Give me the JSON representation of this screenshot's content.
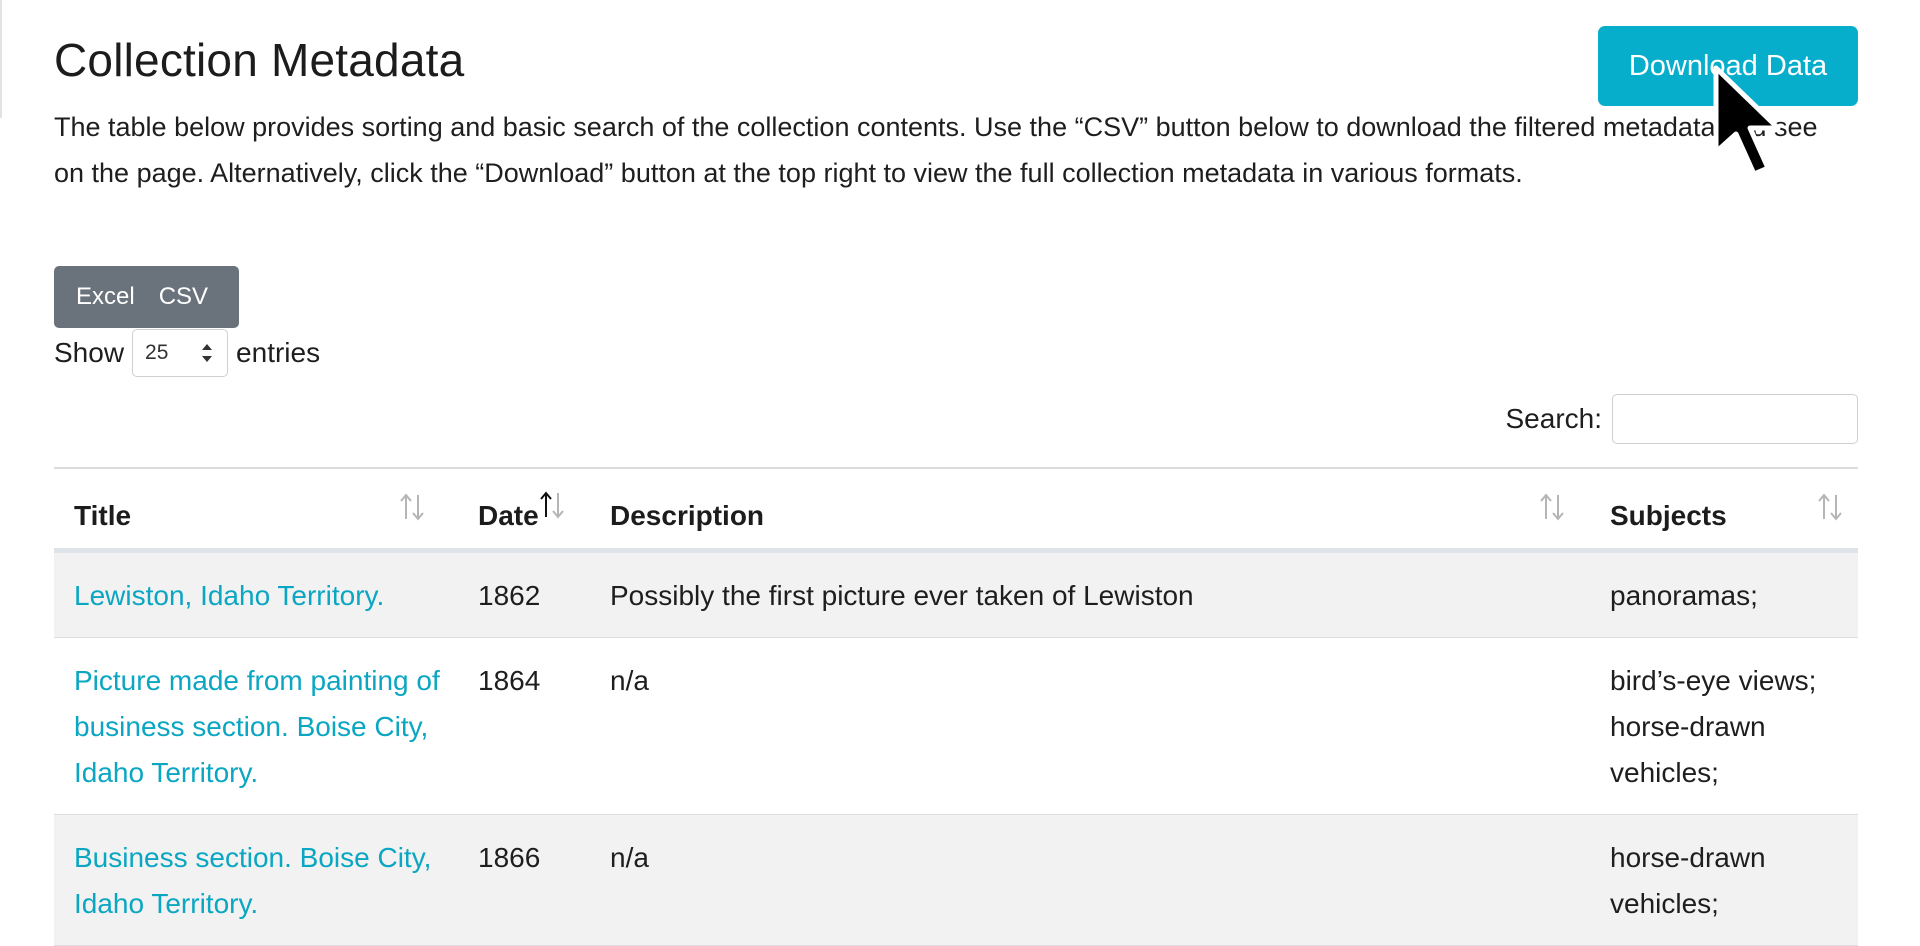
{
  "page": {
    "title": "Collection Metadata",
    "intro": "The table below provides sorting and basic search of the collection contents. Use the “CSV” button below to download the filtered metadata you see on the page. Alternatively, click the “Download” button at the top right to view the full collection metadata in various formats."
  },
  "download_button": {
    "label": "Download Data",
    "color": "#06aecb"
  },
  "export_buttons": {
    "excel": "Excel",
    "csv": "CSV",
    "color": "#6a737c"
  },
  "length_menu": {
    "prefix": "Show",
    "value": "25",
    "suffix": "entries"
  },
  "search": {
    "label": "Search:",
    "value": "",
    "placeholder": ""
  },
  "table": {
    "columns": [
      {
        "label": "Title",
        "sort": "none"
      },
      {
        "label": "Date",
        "sort": "ascending"
      },
      {
        "label": "Description",
        "sort": "none"
      },
      {
        "label": "Subjects",
        "sort": "none"
      }
    ],
    "rows": [
      {
        "title": "Lewiston, Idaho Territory.",
        "date": "1862",
        "description": "Possibly the first picture ever taken of Lewiston",
        "subjects": "panoramas;"
      },
      {
        "title": "Picture made from painting of business section. Boise City, Idaho Territory.",
        "date": "1864",
        "description": "n/a",
        "subjects": "bird’s-eye views; horse-drawn vehicles;"
      },
      {
        "title": "Business section. Boise City, Idaho Territory.",
        "date": "1866",
        "description": "n/a",
        "subjects": "horse-drawn vehicles;"
      }
    ],
    "link_color": "#0aa6c2"
  },
  "icons": {
    "sort": "sort-arrows-icon",
    "select": "select-arrows-icon",
    "cursor": "mouse-pointer-icon"
  }
}
